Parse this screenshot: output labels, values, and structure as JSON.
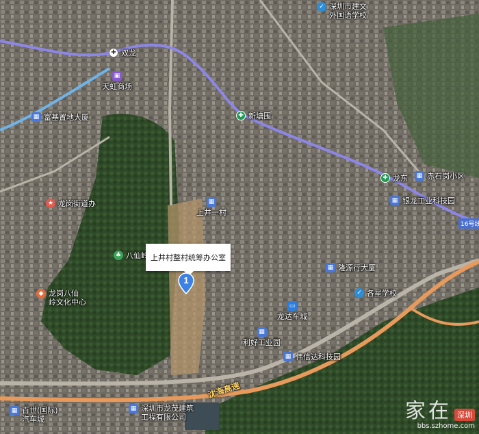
{
  "map": {
    "route_color": "#8c86e8",
    "expressway_color": "#e79a5b",
    "park_color": "#2f5a2a"
  },
  "pois": [
    {
      "name": "poi-shenzhen-jianwen",
      "icon": "school-icon",
      "type": "school",
      "lines": [
        "深圳市建文",
        "外国语学校"
      ]
    },
    {
      "name": "poi-shuanglong",
      "icon": "metro-icon",
      "type": "metro2",
      "lines": [
        "双龙"
      ]
    },
    {
      "name": "poi-tianhong",
      "icon": "shopping-icon",
      "type": "shop",
      "lines": [
        "天虹商场"
      ]
    },
    {
      "name": "poi-fuji",
      "icon": "building-icon",
      "type": "bldg",
      "lines": [
        "富基置地大厦"
      ]
    },
    {
      "name": "poi-xintangwei",
      "icon": "metro-icon",
      "type": "metro",
      "lines": [
        "新塘围"
      ]
    },
    {
      "name": "poi-longdong",
      "icon": "metro-icon",
      "type": "metro",
      "lines": [
        "龙东"
      ]
    },
    {
      "name": "poi-chishigang",
      "icon": "building-icon",
      "type": "bldg",
      "lines": [
        "赤石岗小区"
      ]
    },
    {
      "name": "poi-yinlong",
      "icon": "building-icon",
      "type": "bldg",
      "lines": [
        "银龙工业科技园"
      ]
    },
    {
      "name": "poi-longgang-jiedao",
      "icon": "government-icon",
      "type": "gov",
      "lines": [
        "龙岗街道办"
      ]
    },
    {
      "name": "poi-shangjing",
      "icon": "building-icon",
      "type": "bldg",
      "lines": [
        "上井一村"
      ]
    },
    {
      "name": "poi-baxianling",
      "icon": "park-icon",
      "type": "park",
      "lines": [
        "八仙岭"
      ]
    },
    {
      "name": "poi-longyuan",
      "icon": "building-icon",
      "type": "bldg",
      "lines": [
        "隆源行大厦"
      ]
    },
    {
      "name": "poi-gexing",
      "icon": "school-icon",
      "type": "school",
      "lines": [
        "各星学校"
      ]
    },
    {
      "name": "poi-baxian-culture",
      "icon": "culture-icon",
      "type": "culture",
      "lines": [
        "龙岗八仙",
        "岭文化中心"
      ]
    },
    {
      "name": "poi-longda",
      "icon": "bus-station-icon",
      "type": "bus",
      "lines": [
        "龙达车城"
      ]
    },
    {
      "name": "poi-lihao",
      "icon": "building-icon",
      "type": "bldg",
      "lines": [
        "利好工业园"
      ]
    },
    {
      "name": "poi-weixinda",
      "icon": "building-icon",
      "type": "bldg",
      "lines": [
        "伟信达科技园"
      ]
    },
    {
      "name": "poi-baishi",
      "icon": "building-icon",
      "type": "bldg",
      "lines": [
        "百世(国际)",
        "汽车城"
      ]
    },
    {
      "name": "poi-longmao",
      "icon": "building-icon",
      "type": "bldg",
      "lines": [
        "深圳市龙茂建筑",
        "工程有限公司"
      ]
    }
  ],
  "road_label": "沈海高速",
  "line_badge": "16号线(",
  "callout": {
    "text": "上井村整村统筹办公室",
    "pin_number": "1"
  },
  "watermark": {
    "brand": "家在",
    "tag": "深圳",
    "url": "bbs.szhome.com"
  }
}
